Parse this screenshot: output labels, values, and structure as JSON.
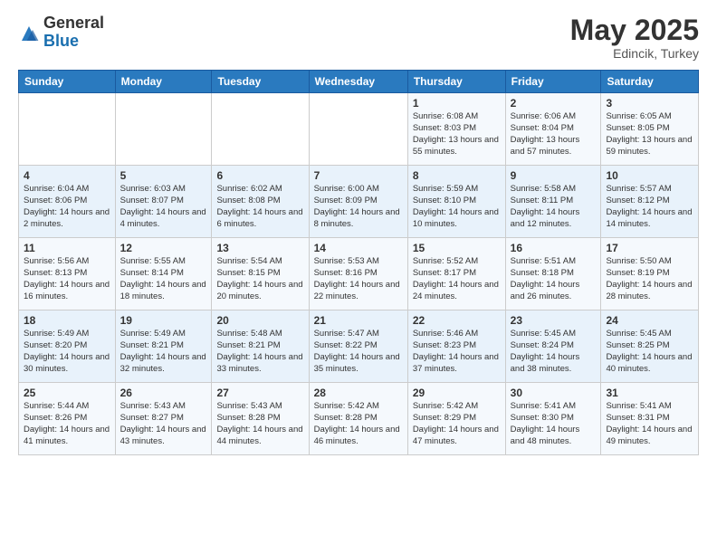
{
  "logo": {
    "general": "General",
    "blue": "Blue"
  },
  "title": "May 2025",
  "subtitle": "Edincik, Turkey",
  "header_days": [
    "Sunday",
    "Monday",
    "Tuesday",
    "Wednesday",
    "Thursday",
    "Friday",
    "Saturday"
  ],
  "weeks": [
    [
      {
        "day": "",
        "sunrise": "",
        "sunset": "",
        "daylight": ""
      },
      {
        "day": "",
        "sunrise": "",
        "sunset": "",
        "daylight": ""
      },
      {
        "day": "",
        "sunrise": "",
        "sunset": "",
        "daylight": ""
      },
      {
        "day": "",
        "sunrise": "",
        "sunset": "",
        "daylight": ""
      },
      {
        "day": "1",
        "sunrise": "Sunrise: 6:08 AM",
        "sunset": "Sunset: 8:03 PM",
        "daylight": "Daylight: 13 hours and 55 minutes."
      },
      {
        "day": "2",
        "sunrise": "Sunrise: 6:06 AM",
        "sunset": "Sunset: 8:04 PM",
        "daylight": "Daylight: 13 hours and 57 minutes."
      },
      {
        "day": "3",
        "sunrise": "Sunrise: 6:05 AM",
        "sunset": "Sunset: 8:05 PM",
        "daylight": "Daylight: 13 hours and 59 minutes."
      }
    ],
    [
      {
        "day": "4",
        "sunrise": "Sunrise: 6:04 AM",
        "sunset": "Sunset: 8:06 PM",
        "daylight": "Daylight: 14 hours and 2 minutes."
      },
      {
        "day": "5",
        "sunrise": "Sunrise: 6:03 AM",
        "sunset": "Sunset: 8:07 PM",
        "daylight": "Daylight: 14 hours and 4 minutes."
      },
      {
        "day": "6",
        "sunrise": "Sunrise: 6:02 AM",
        "sunset": "Sunset: 8:08 PM",
        "daylight": "Daylight: 14 hours and 6 minutes."
      },
      {
        "day": "7",
        "sunrise": "Sunrise: 6:00 AM",
        "sunset": "Sunset: 8:09 PM",
        "daylight": "Daylight: 14 hours and 8 minutes."
      },
      {
        "day": "8",
        "sunrise": "Sunrise: 5:59 AM",
        "sunset": "Sunset: 8:10 PM",
        "daylight": "Daylight: 14 hours and 10 minutes."
      },
      {
        "day": "9",
        "sunrise": "Sunrise: 5:58 AM",
        "sunset": "Sunset: 8:11 PM",
        "daylight": "Daylight: 14 hours and 12 minutes."
      },
      {
        "day": "10",
        "sunrise": "Sunrise: 5:57 AM",
        "sunset": "Sunset: 8:12 PM",
        "daylight": "Daylight: 14 hours and 14 minutes."
      }
    ],
    [
      {
        "day": "11",
        "sunrise": "Sunrise: 5:56 AM",
        "sunset": "Sunset: 8:13 PM",
        "daylight": "Daylight: 14 hours and 16 minutes."
      },
      {
        "day": "12",
        "sunrise": "Sunrise: 5:55 AM",
        "sunset": "Sunset: 8:14 PM",
        "daylight": "Daylight: 14 hours and 18 minutes."
      },
      {
        "day": "13",
        "sunrise": "Sunrise: 5:54 AM",
        "sunset": "Sunset: 8:15 PM",
        "daylight": "Daylight: 14 hours and 20 minutes."
      },
      {
        "day": "14",
        "sunrise": "Sunrise: 5:53 AM",
        "sunset": "Sunset: 8:16 PM",
        "daylight": "Daylight: 14 hours and 22 minutes."
      },
      {
        "day": "15",
        "sunrise": "Sunrise: 5:52 AM",
        "sunset": "Sunset: 8:17 PM",
        "daylight": "Daylight: 14 hours and 24 minutes."
      },
      {
        "day": "16",
        "sunrise": "Sunrise: 5:51 AM",
        "sunset": "Sunset: 8:18 PM",
        "daylight": "Daylight: 14 hours and 26 minutes."
      },
      {
        "day": "17",
        "sunrise": "Sunrise: 5:50 AM",
        "sunset": "Sunset: 8:19 PM",
        "daylight": "Daylight: 14 hours and 28 minutes."
      }
    ],
    [
      {
        "day": "18",
        "sunrise": "Sunrise: 5:49 AM",
        "sunset": "Sunset: 8:20 PM",
        "daylight": "Daylight: 14 hours and 30 minutes."
      },
      {
        "day": "19",
        "sunrise": "Sunrise: 5:49 AM",
        "sunset": "Sunset: 8:21 PM",
        "daylight": "Daylight: 14 hours and 32 minutes."
      },
      {
        "day": "20",
        "sunrise": "Sunrise: 5:48 AM",
        "sunset": "Sunset: 8:21 PM",
        "daylight": "Daylight: 14 hours and 33 minutes."
      },
      {
        "day": "21",
        "sunrise": "Sunrise: 5:47 AM",
        "sunset": "Sunset: 8:22 PM",
        "daylight": "Daylight: 14 hours and 35 minutes."
      },
      {
        "day": "22",
        "sunrise": "Sunrise: 5:46 AM",
        "sunset": "Sunset: 8:23 PM",
        "daylight": "Daylight: 14 hours and 37 minutes."
      },
      {
        "day": "23",
        "sunrise": "Sunrise: 5:45 AM",
        "sunset": "Sunset: 8:24 PM",
        "daylight": "Daylight: 14 hours and 38 minutes."
      },
      {
        "day": "24",
        "sunrise": "Sunrise: 5:45 AM",
        "sunset": "Sunset: 8:25 PM",
        "daylight": "Daylight: 14 hours and 40 minutes."
      }
    ],
    [
      {
        "day": "25",
        "sunrise": "Sunrise: 5:44 AM",
        "sunset": "Sunset: 8:26 PM",
        "daylight": "Daylight: 14 hours and 41 minutes."
      },
      {
        "day": "26",
        "sunrise": "Sunrise: 5:43 AM",
        "sunset": "Sunset: 8:27 PM",
        "daylight": "Daylight: 14 hours and 43 minutes."
      },
      {
        "day": "27",
        "sunrise": "Sunrise: 5:43 AM",
        "sunset": "Sunset: 8:28 PM",
        "daylight": "Daylight: 14 hours and 44 minutes."
      },
      {
        "day": "28",
        "sunrise": "Sunrise: 5:42 AM",
        "sunset": "Sunset: 8:28 PM",
        "daylight": "Daylight: 14 hours and 46 minutes."
      },
      {
        "day": "29",
        "sunrise": "Sunrise: 5:42 AM",
        "sunset": "Sunset: 8:29 PM",
        "daylight": "Daylight: 14 hours and 47 minutes."
      },
      {
        "day": "30",
        "sunrise": "Sunrise: 5:41 AM",
        "sunset": "Sunset: 8:30 PM",
        "daylight": "Daylight: 14 hours and 48 minutes."
      },
      {
        "day": "31",
        "sunrise": "Sunrise: 5:41 AM",
        "sunset": "Sunset: 8:31 PM",
        "daylight": "Daylight: 14 hours and 49 minutes."
      }
    ]
  ]
}
